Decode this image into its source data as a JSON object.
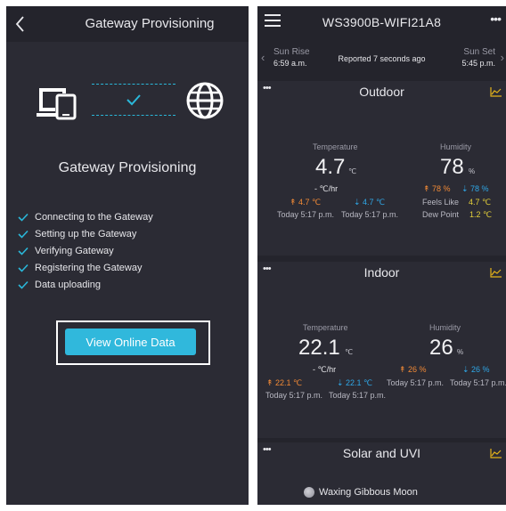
{
  "left": {
    "title": "Gateway Provisioning",
    "heading": "Gateway Provisioning",
    "steps": [
      "Connecting to the Gateway",
      "Setting up the Gateway",
      "Verifying Gateway",
      "Registering the Gateway",
      "Data uploading"
    ],
    "button_label": "View Online Data"
  },
  "right": {
    "title": "WS3900B-WIFI21A8",
    "sun": {
      "rise_label": "Sun Rise",
      "rise_time": "6:59 a.m.",
      "reported": "Reported 7 seconds ago",
      "set_label": "Sun Set",
      "set_time": "5:45 p.m."
    },
    "outdoor": {
      "title": "Outdoor",
      "temp_label": "Temperature",
      "temp_value": "4.7",
      "temp_unit": "℃",
      "temp_rate": "- ℃/hr",
      "temp_high": "↟ 4.7 ℃",
      "temp_low": "⇣ 4.7 ℃",
      "temp_high_time": "Today 5:17 p.m.",
      "temp_low_time": "Today 5:17 p.m.",
      "hum_label": "Humidity",
      "hum_value": "78",
      "hum_unit": "%",
      "hum_high": "↟ 78 %",
      "hum_low": "⇣ 78 %",
      "feels_label": "Feels Like",
      "feels_value": "4.7 ℃",
      "dew_label": "Dew Point",
      "dew_value": "1.2 ℃"
    },
    "indoor": {
      "title": "Indoor",
      "temp_label": "Temperature",
      "temp_value": "22.1",
      "temp_unit": "℃",
      "temp_rate": "- ℃/hr",
      "temp_high": "↟ 22.1 ℃",
      "temp_low": "⇣ 22.1 ℃",
      "temp_high_time": "Today 5:17 p.m.",
      "temp_low_time": "Today 5:17 p.m.",
      "hum_label": "Humidity",
      "hum_value": "26",
      "hum_unit": "%",
      "hum_high": "↟ 26 %",
      "hum_low": "⇣ 26 %",
      "hum_high_time": "Today 5:17 p.m.",
      "hum_low_time": "Today 5:17 p.m."
    },
    "solar": {
      "title": "Solar and UVI",
      "moon_phase": "Waxing Gibbous Moon"
    }
  },
  "icons": {
    "back": "chevron-left-icon",
    "devices": "devices-icon",
    "check": "check-icon",
    "globe": "globe-icon",
    "menu": "hamburger-menu-icon",
    "more": "more-horizontal-icon",
    "chart": "line-chart-icon",
    "moon": "moon-icon"
  },
  "colors": {
    "accent": "#30b8dc",
    "high": "#f28a36",
    "low": "#2fa8e8",
    "derived": "#e3cf3a",
    "chart_icon": "#e3b21a"
  }
}
